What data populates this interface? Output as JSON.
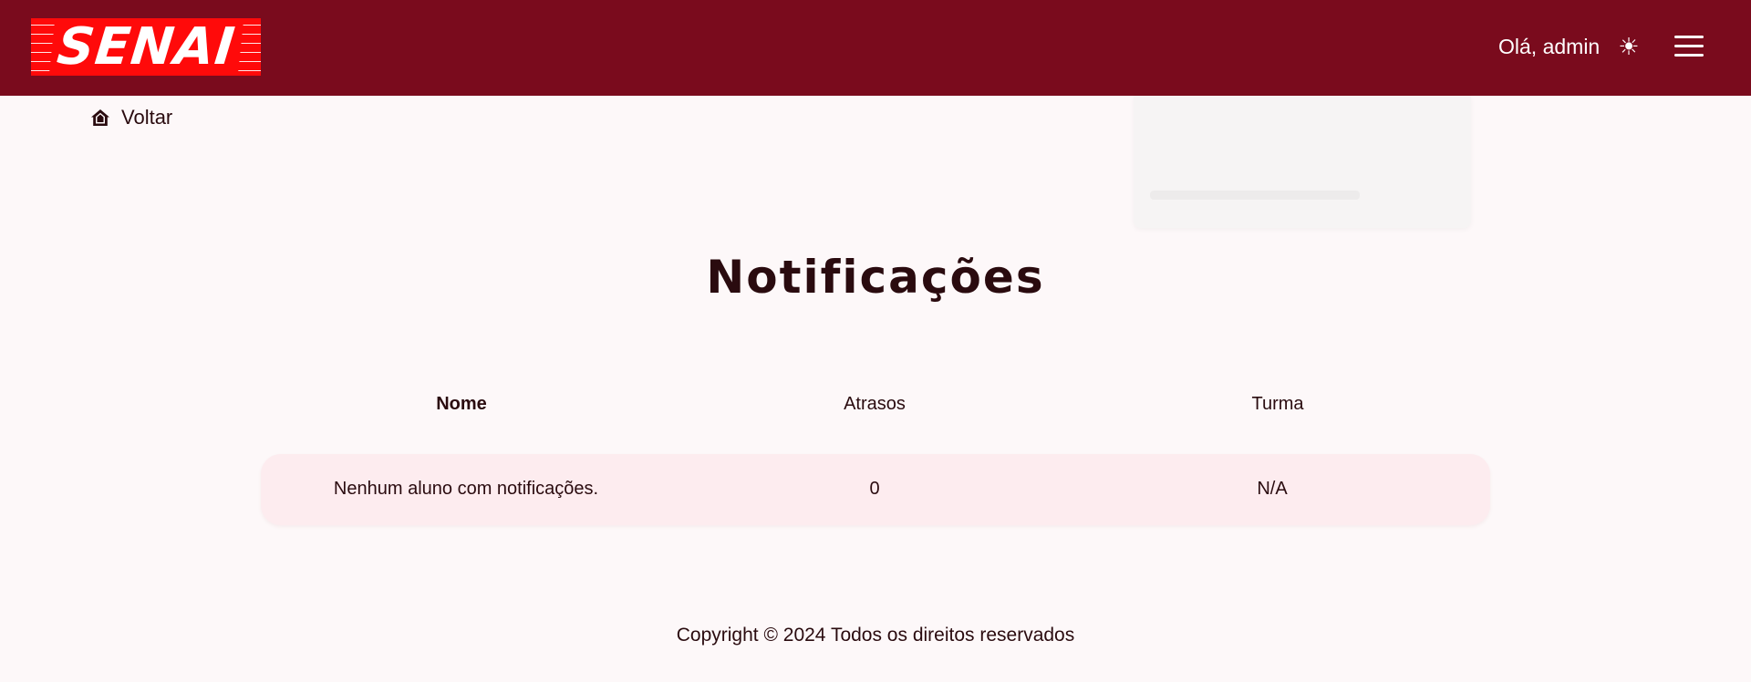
{
  "header": {
    "logo_text": "SENAI",
    "greeting": "Olá, admin",
    "theme_icon": "sun-icon",
    "menu_icon": "hamburger-menu-icon",
    "background_color": "#7a0b1d",
    "logo_color": "#ff0a0a"
  },
  "nav": {
    "back_label": "Voltar",
    "back_icon": "home-icon"
  },
  "main": {
    "title": "Notificações",
    "table": {
      "columns": [
        "Nome",
        "Atrasos",
        "Turma"
      ],
      "rows": [
        [
          "Nenhum aluno com notificações.",
          "0",
          "N/A"
        ]
      ]
    }
  },
  "footer": {
    "copyright": "Copyright © 2024 Todos os direitos reservados"
  }
}
